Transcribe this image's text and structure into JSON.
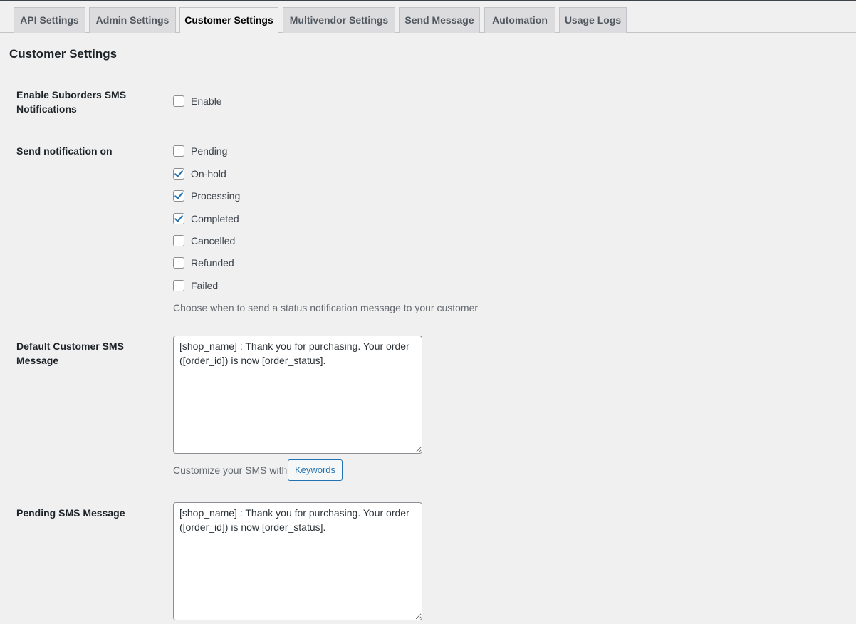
{
  "tabs": [
    {
      "label": "API Settings",
      "active": false
    },
    {
      "label": "Admin Settings",
      "active": false
    },
    {
      "label": "Customer Settings",
      "active": true
    },
    {
      "label": "Multivendor Settings",
      "active": false
    },
    {
      "label": "Send Message",
      "active": false
    },
    {
      "label": "Automation",
      "active": false
    },
    {
      "label": "Usage Logs",
      "active": false
    }
  ],
  "page_title": "Customer Settings",
  "suborders": {
    "label": "Enable Suborders SMS Notifications",
    "checkbox_label": "Enable",
    "checked": false
  },
  "send_notification": {
    "label": "Send notification on",
    "options": [
      {
        "label": "Pending",
        "checked": false
      },
      {
        "label": "On-hold",
        "checked": true
      },
      {
        "label": "Processing",
        "checked": true
      },
      {
        "label": "Completed",
        "checked": true
      },
      {
        "label": "Cancelled",
        "checked": false
      },
      {
        "label": "Refunded",
        "checked": false
      },
      {
        "label": "Failed",
        "checked": false
      }
    ],
    "hint": "Choose when to send a status notification message to your customer"
  },
  "default_message": {
    "label": "Default Customer SMS Message",
    "value": "[shop_name] : Thank you for purchasing. Your order ([order_id]) is now [order_status].",
    "customize_hint": "Customize your SMS with",
    "keywords_button": "Keywords"
  },
  "pending_message": {
    "label": "Pending SMS Message",
    "value": "[shop_name] : Thank you for purchasing. Your order ([order_id]) is now [order_status]."
  },
  "colors": {
    "background": "#f0f0f1",
    "checkmark": "#2271b1",
    "button_accent": "#2271b1",
    "tab_inactive": "#dcdcde"
  }
}
